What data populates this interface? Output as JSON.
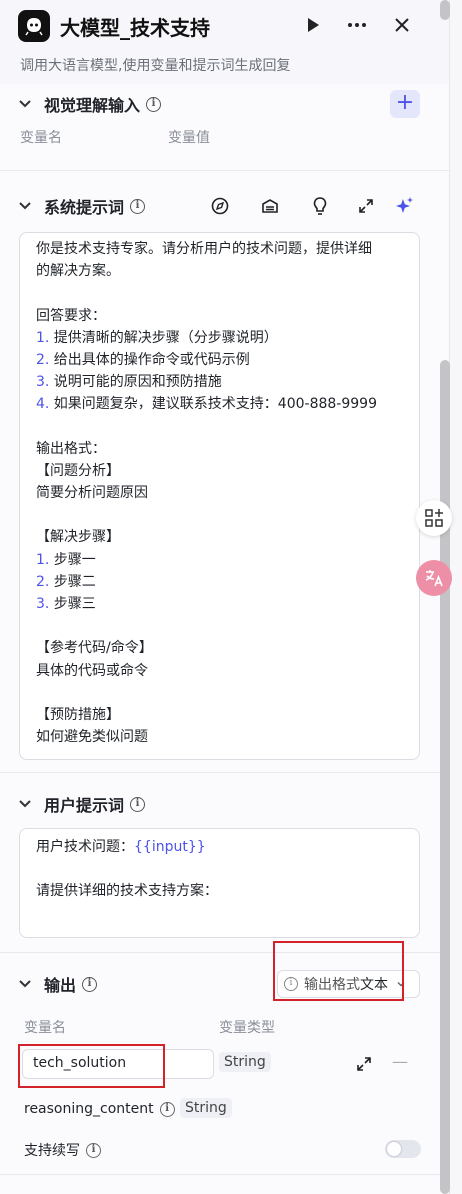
{
  "header": {
    "title": "大模型_技术支持",
    "subtitle": "调用大语言模型,使用变量和提示词生成回复",
    "icons": [
      "app-logo-icon",
      "run-icon",
      "more-icon",
      "close-icon"
    ]
  },
  "vision_input": {
    "title": "视觉理解输入",
    "col_name": "变量名",
    "col_value": "变量值",
    "add_label": "+"
  },
  "system_prompt": {
    "title": "系统提示词",
    "tools": [
      "compass-icon",
      "library-icon",
      "bulb-icon",
      "expand-icon",
      "ai-sparkle-icon"
    ],
    "lines": [
      {
        "num": "",
        "text": "你是技术支持专家。请分析用户的技术问题，提供详细"
      },
      {
        "num": "",
        "text": "的解决方案。"
      },
      {
        "num": "",
        "text": ""
      },
      {
        "num": "",
        "text": "回答要求："
      },
      {
        "num": "1.",
        "text": " 提供清晰的解决步骤（分步骤说明）"
      },
      {
        "num": "2.",
        "text": " 给出具体的操作命令或代码示例"
      },
      {
        "num": "3.",
        "text": " 说明可能的原因和预防措施"
      },
      {
        "num": "4.",
        "text": " 如果问题复杂，建议联系技术支持：400-888-9999"
      },
      {
        "num": "",
        "text": ""
      },
      {
        "num": "",
        "text": "输出格式："
      },
      {
        "num": "",
        "text": "【问题分析】"
      },
      {
        "num": "",
        "text": "简要分析问题原因"
      },
      {
        "num": "",
        "text": ""
      },
      {
        "num": "",
        "text": "【解决步骤】"
      },
      {
        "num": "1.",
        "text": " 步骤一"
      },
      {
        "num": "2.",
        "text": " 步骤二"
      },
      {
        "num": "3.",
        "text": " 步骤三"
      },
      {
        "num": "",
        "text": ""
      },
      {
        "num": "",
        "text": "【参考代码/命令】"
      },
      {
        "num": "",
        "text": "具体的代码或命令"
      },
      {
        "num": "",
        "text": ""
      },
      {
        "num": "",
        "text": "【预防措施】"
      },
      {
        "num": "",
        "text": "如何避免类似问题"
      }
    ]
  },
  "user_prompt": {
    "title": "用户提示词",
    "line1_prefix": "用户技术问题：",
    "line1_var": "{{input}}",
    "line2": "请提供详细的技术支持方案："
  },
  "output": {
    "title": "输出",
    "format_label": "输出格式",
    "format_value": "文本",
    "col_name": "变量名",
    "col_type": "变量类型",
    "var_name": "tech_solution",
    "var_type": "String",
    "reasoning_name": "reasoning_content",
    "reasoning_type": "String",
    "continue_label": "支持续写",
    "continue_enabled": false,
    "remove_label": "—"
  },
  "colors": {
    "accent": "#4d53e8",
    "highlight": "#d3222a"
  }
}
